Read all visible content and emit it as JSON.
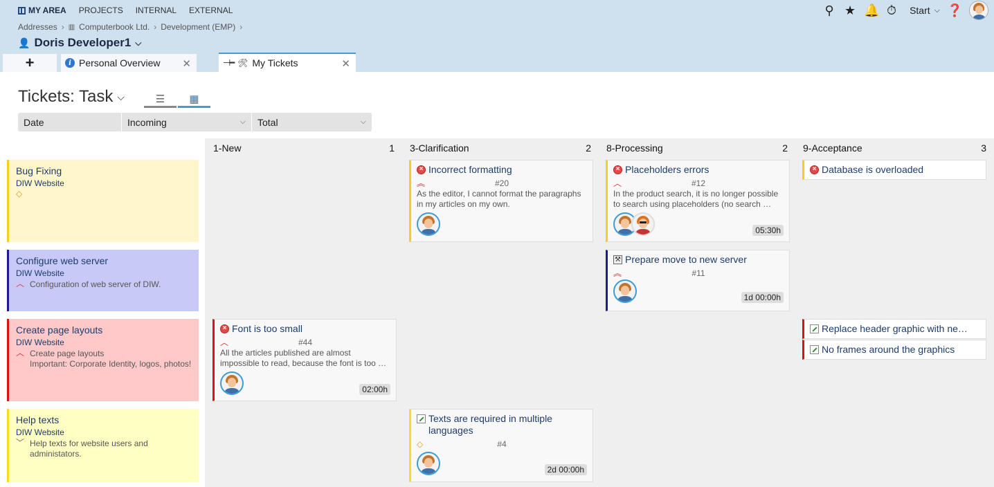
{
  "nav": {
    "items": [
      "MY AREA",
      "PROJECTS",
      "INTERNAL",
      "EXTERNAL"
    ]
  },
  "breadcrumb": [
    "Addresses",
    "Computerbook Ltd.",
    "Development (EMP)"
  ],
  "user": {
    "name": "Doris Developer1"
  },
  "topbar": {
    "start_label": "Start"
  },
  "tabs": {
    "add": "+",
    "personal": "Personal Overview",
    "mytickets": "My Tickets"
  },
  "page": {
    "title": "Tickets: Task"
  },
  "filters": {
    "date": "Date",
    "incoming": "Incoming",
    "total": "Total"
  },
  "columns": [
    {
      "name": "1-New",
      "count": "1"
    },
    {
      "name": "3-Clarification",
      "count": "2"
    },
    {
      "name": "8-Processing",
      "count": "2"
    },
    {
      "name": "9-Acceptance",
      "count": "3"
    }
  ],
  "swimlanes": [
    {
      "title": "Bug Fixing",
      "project": "DIW Website",
      "desc": "",
      "color": "#fff6cc",
      "border": "#f0d020"
    },
    {
      "title": "Configure web server",
      "project": "DIW Website",
      "desc": "Configuration of web server of DIW.",
      "color": "#c9c9f7",
      "border": "#1a1aa0"
    },
    {
      "title": "Create page layouts",
      "project": "DIW Website",
      "desc": "Create page layouts",
      "desc2": "Important: Corporate Identity, logos, photos!",
      "color": "#ffc9c9",
      "border": "#d11"
    },
    {
      "title": "Help texts",
      "project": "DIW Website",
      "desc": "Help texts for website users and administators.",
      "color": "#ffffc4",
      "border": "#f0e020"
    }
  ],
  "cards": {
    "c20": {
      "title": "Incorrect formatting",
      "number": "#20",
      "desc": "As the editor, I cannot format the paragraphs in my articles on my own."
    },
    "c12": {
      "title": "Placeholders errors",
      "number": "#12",
      "desc": "In the product search, it is no longer possible to search using placeholders (no search …",
      "time": "05:30h"
    },
    "c11": {
      "title": "Prepare move to new server",
      "number": "#11",
      "time": "1d 00:00h"
    },
    "cdb": {
      "title": "Database is overloaded"
    },
    "c44": {
      "title": "Font is too small",
      "number": "#44",
      "desc": "All the articles published are almost impossible to read, because the font is too …",
      "time": "02:00h"
    },
    "chg": {
      "title": "Replace header graphic with ne…"
    },
    "cfr": {
      "title": "No frames around the graphics"
    },
    "c4": {
      "title": "Texts are required in multiple languages",
      "number": "#4",
      "time": "2d 00:00h"
    }
  }
}
